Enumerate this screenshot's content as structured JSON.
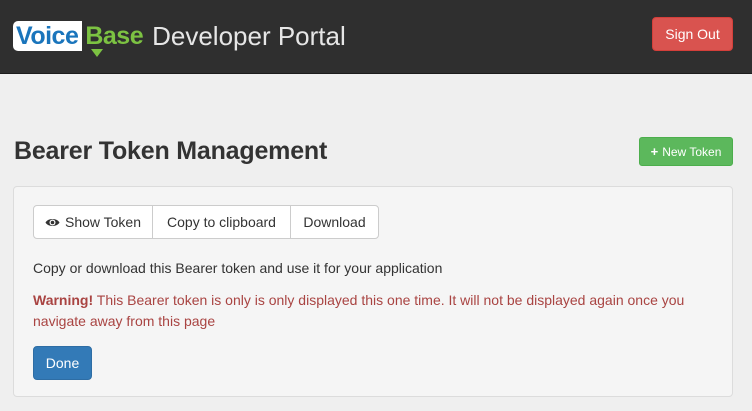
{
  "header": {
    "logo_voice": "Voice",
    "logo_base": "Base",
    "portal_title": "Developer Portal",
    "sign_out_label": "Sign Out"
  },
  "page": {
    "title": "Bearer Token Management",
    "new_token_label": "New Token"
  },
  "panel": {
    "toolbar": {
      "show_token_label": "Show Token",
      "copy_label": "Copy to clipboard",
      "download_label": "Download"
    },
    "info_text": "Copy or download this Bearer token and use it for your application",
    "warning_label": "Warning!",
    "warning_text": "This Bearer token is only is only displayed this one time. It will not be displayed again once you navigate away from this page",
    "done_label": "Done"
  },
  "colors": {
    "navbar_bg": "#2f2f2f",
    "brand_blue": "#1a75bc",
    "brand_green": "#7cc242",
    "danger": "#d9534f",
    "success": "#5cb85c",
    "primary": "#337ab7",
    "warning_text": "#a94442"
  },
  "icons": {
    "new_token": "plus-icon",
    "show_token": "eye-icon"
  }
}
